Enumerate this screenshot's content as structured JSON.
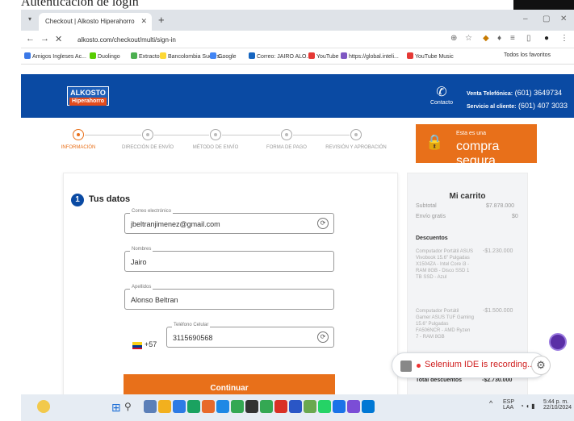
{
  "caption": {
    "text": "Autenticación de login"
  },
  "browser": {
    "tab_title": "Checkout | Alkosto Hiperahorro",
    "url": "alkosto.com/checkout/multi/sign-in",
    "bookmarks": [
      {
        "label": "Amigos Ingleses Ac...",
        "color": "#3b78e7"
      },
      {
        "label": "Duolingo",
        "color": "#58cc02"
      },
      {
        "label": "Extracto",
        "color": "#4caf50"
      },
      {
        "label": "Bancolombia Sucurs...",
        "color": "#fdd835"
      },
      {
        "label": "Google",
        "color": "#4285f4"
      },
      {
        "label": "Correo: JAIRO ALO...",
        "color": "#1565c0"
      },
      {
        "label": "YouTube",
        "color": "#e53935"
      },
      {
        "label": "https://global.inteli...",
        "color": "#7e57c2"
      },
      {
        "label": "YouTube Music",
        "color": "#e53935"
      }
    ],
    "all_bookmarks": "Todos los favoritos"
  },
  "header": {
    "logo_main": "ALKOSTO",
    "logo_sub": "Hiperahorro",
    "contact_label": "Contacto",
    "phone_sales_label": "Venta Telefónica:",
    "phone_sales": "(601) 3649734",
    "phone_service_label": "Servicio al cliente:",
    "phone_service": "(601) 407 3033"
  },
  "steps": [
    {
      "label": "INFORMACIÓN",
      "active": true
    },
    {
      "label": "DIRECCIÓN DE ENVÍO",
      "active": false
    },
    {
      "label": "MÉTODO DE ENVÍO",
      "active": false
    },
    {
      "label": "FORMA DE PAGO",
      "active": false
    },
    {
      "label": "REVISIÓN Y APROBACIÓN",
      "active": false
    }
  ],
  "secure": {
    "line1": "Esta es una",
    "line2": "compra segura"
  },
  "form": {
    "section_number": "1",
    "section_title": "Tus datos",
    "email": {
      "label": "Correo electrónico",
      "value": "jbeltranjimenez@gmail.com"
    },
    "name": {
      "label": "Nombres",
      "value": "Jairo"
    },
    "lastname": {
      "label": "Apellidos",
      "value": "Alonso Beltran"
    },
    "phone": {
      "label": "Teléfono Celular",
      "prefix": "+57",
      "value": "3115690568"
    },
    "submit": "Continuar"
  },
  "cart": {
    "title": "Mi carrito",
    "subtotal_label": "Subtotal",
    "subtotal": "$7.878.000",
    "shipping_label": "Envío gratis",
    "shipping": "$0",
    "discounts_title": "Descuentos",
    "discounts": [
      {
        "desc": "Computador Portátil ASUS Vivobook 15.6\" Pulgadas X1504ZA - Intel Core i3 - RAM 8GB - Disco SSD 1 TB SSD - Azul",
        "amount": "-$1.230.000"
      },
      {
        "desc": "Computador Portátil Gamer ASUS TUF Gaming 15.6\" Pulgadas FA506NCR - AMD Ryzen 7 - RAM 8GB",
        "amount": "-$1.500.000"
      }
    ],
    "total_discounts_label": "Total descuentos",
    "total_discounts": "-$2.730.000"
  },
  "selenium": {
    "text": "Selenium IDE is recording..."
  },
  "taskbar": {
    "lang": "ESP",
    "lang2": "LAA",
    "time": "5:44 p. m.",
    "date": "22/10/2024"
  }
}
